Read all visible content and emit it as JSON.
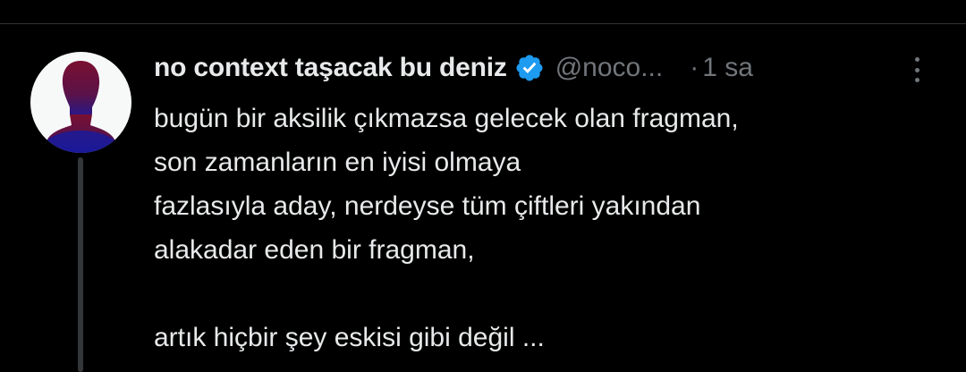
{
  "tweet": {
    "author": {
      "display_name": "no context taşacak bu deniz",
      "handle": "@noco...",
      "verified": true,
      "verified_icon": "verified-badge-icon",
      "avatar_icon": "silhouette-avatar-icon"
    },
    "separator": "·",
    "time": "1 sa",
    "more_icon": "more-dots-vertical-icon",
    "text_lines": [
      "bugün bir aksilik çıkmazsa gelecek olan fragman,",
      "son zamanların en iyisi olmaya",
      "fazlasıyla aday, nerdeyse tüm çiftleri yakından",
      "alakadar eden bir fragman,",
      "",
      "artık hiçbir şey eskisi gibi değil ..."
    ]
  },
  "colors": {
    "background": "#000000",
    "text_primary": "#e7e9ea",
    "text_secondary": "#71767b",
    "verified_blue": "#1d9bf0",
    "thread_line": "#333639",
    "avatar_background": "#f7f9f9",
    "avatar_silhouette_top": "#7a1030",
    "avatar_silhouette_bottom": "#1a1a9a"
  }
}
